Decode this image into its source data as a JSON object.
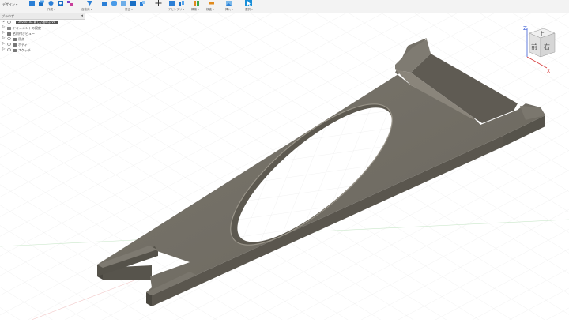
{
  "toolbar": {
    "workspace": "デザイン ▾",
    "groups": [
      {
        "label": "作成 ▾"
      },
      {
        "label": "自動化 ▾"
      },
      {
        "label": "修正 ▾"
      },
      {
        "label": "アセンブリ ▾"
      },
      {
        "label": "構築 ▾"
      },
      {
        "label": "検査 ▾"
      },
      {
        "label": "挿入 ▾"
      },
      {
        "label": "選択 ▾"
      }
    ]
  },
  "browser": {
    "title": "ブラウザ",
    "pin": "◂",
    "root": "202101XX 新しい板のふ v1",
    "items": [
      {
        "label": "ドキュメントの設定"
      },
      {
        "label": "名前付きビュー"
      },
      {
        "label": "原点"
      },
      {
        "label": "ボディ"
      },
      {
        "label": "スケッチ"
      }
    ]
  },
  "viewcube": {
    "top": "上",
    "front": "前",
    "right": "右",
    "axis_z": "Z",
    "axis_x": "X"
  },
  "colors": {
    "part": "#6e6a62",
    "part_top": "#78746b",
    "part_side": "#4a4740",
    "grid": "#e4e4e4",
    "accent": "#0696d7"
  }
}
